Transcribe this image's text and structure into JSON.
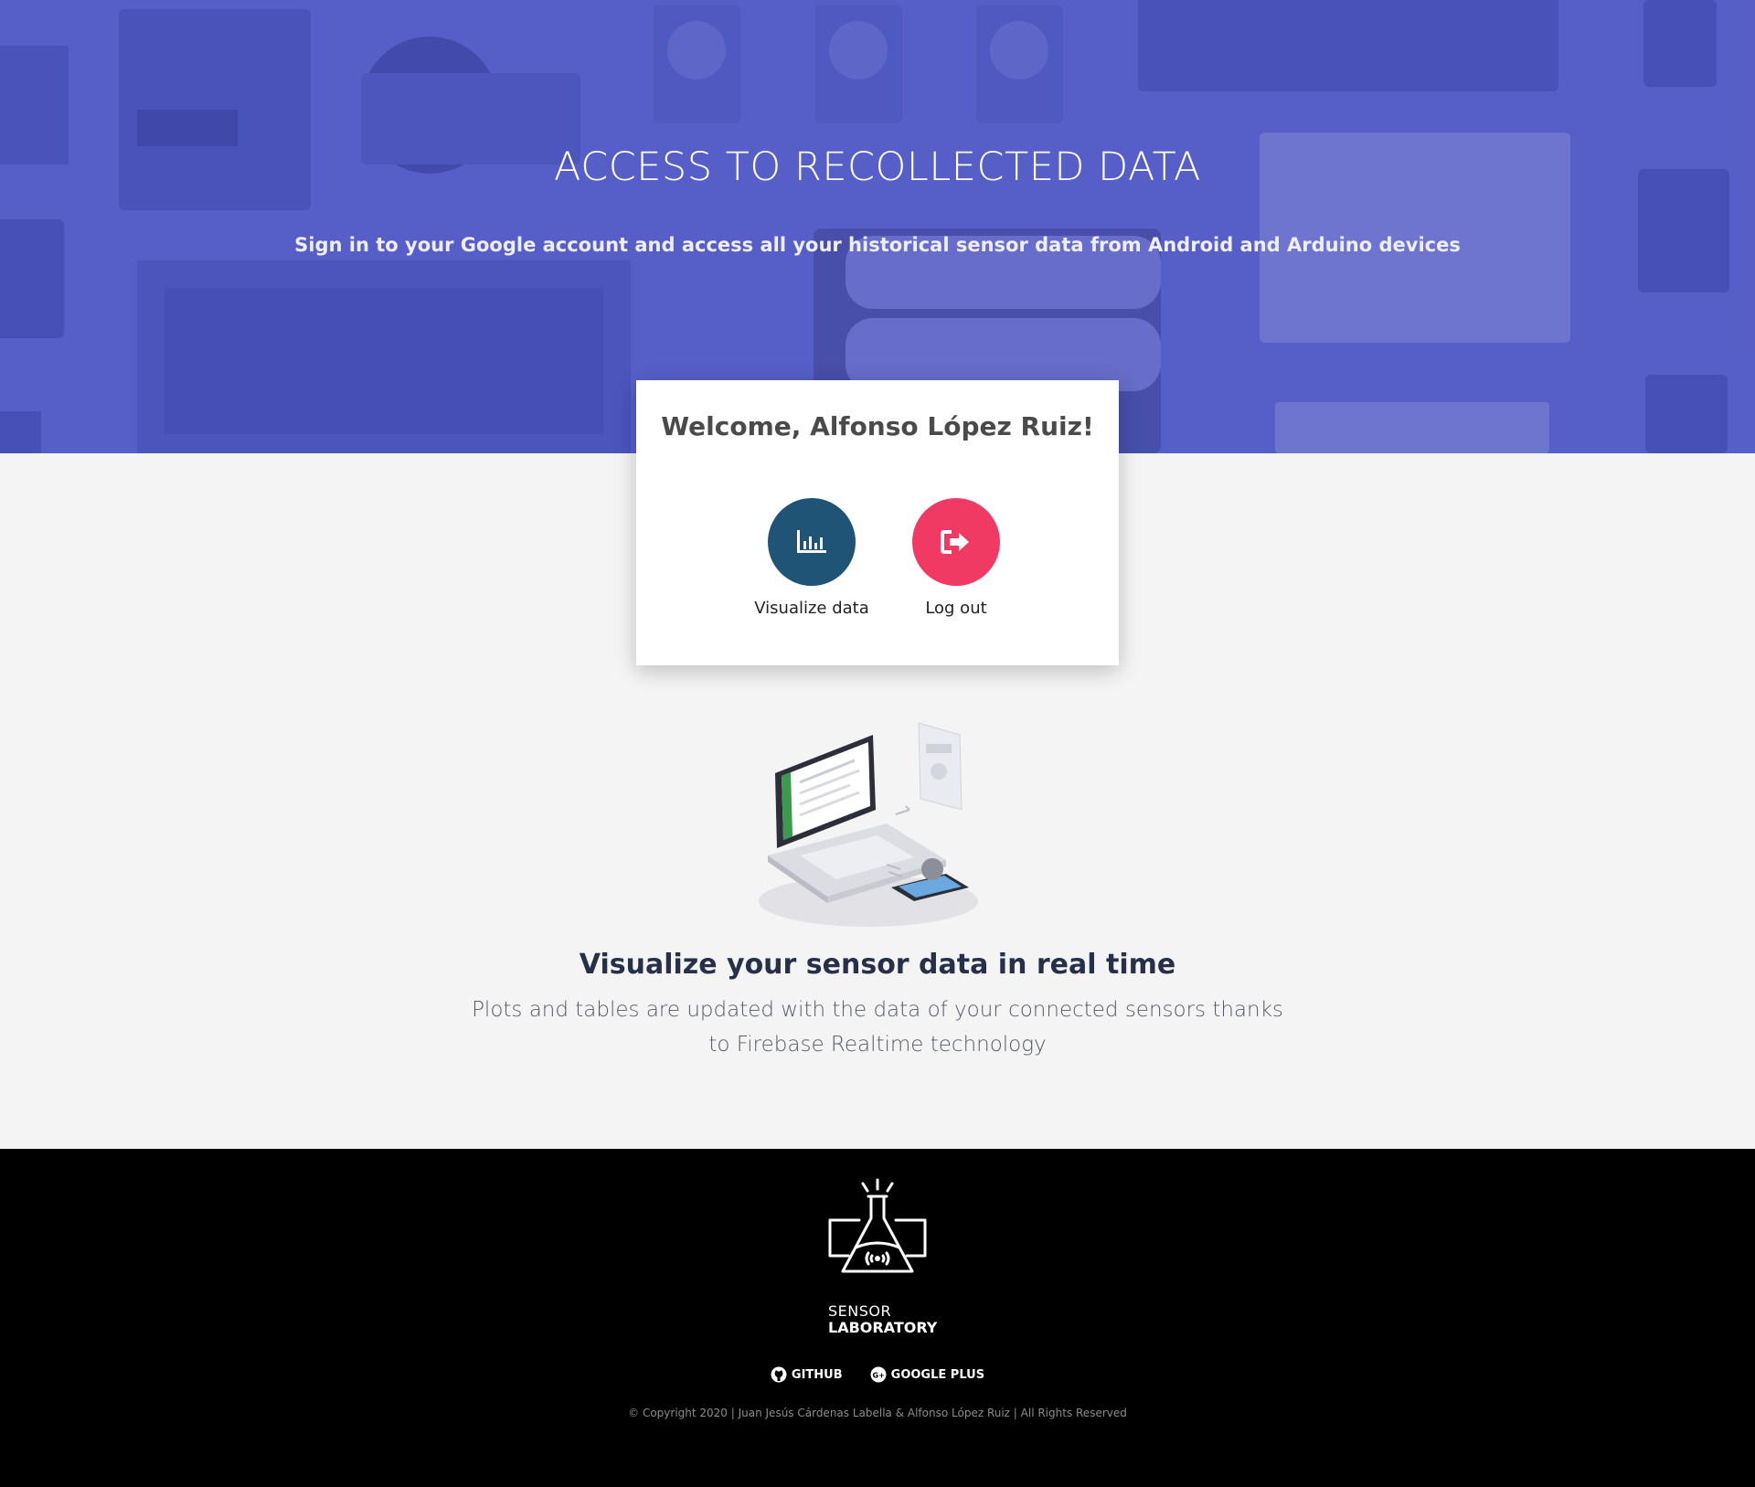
{
  "hero": {
    "title": "ACCESS TO RECOLLECTED DATA",
    "subtitle": "Sign in to your Google account and access all your historical sensor data from Android and Arduino devices",
    "overlay_color": "#5a62c6"
  },
  "card": {
    "welcome": "Welcome, Alfonso López Ruiz!",
    "actions": [
      {
        "label": "Visualize data",
        "icon": "bar-chart-icon",
        "color": "#1f5476"
      },
      {
        "label": "Log out",
        "icon": "sign-out-icon",
        "color": "#f03a63"
      }
    ]
  },
  "feature": {
    "title": "Visualize your sensor data in real time",
    "description": "Plots and tables are updated with the data of your connected sensors thanks to Firebase Realtime technology",
    "illustration": "laptop-sync-illustration"
  },
  "footer": {
    "logo_line1": "SENSOR",
    "logo_line2": "LABORATORY",
    "links": [
      {
        "label": "GITHUB",
        "icon": "github-icon"
      },
      {
        "label": "GOOGLE PLUS",
        "icon": "google-plus-icon"
      }
    ],
    "copyright": "© Copyright 2020 | Juan Jesús Cárdenas Labella & Alfonso López Ruiz | All Rights Reserved"
  }
}
